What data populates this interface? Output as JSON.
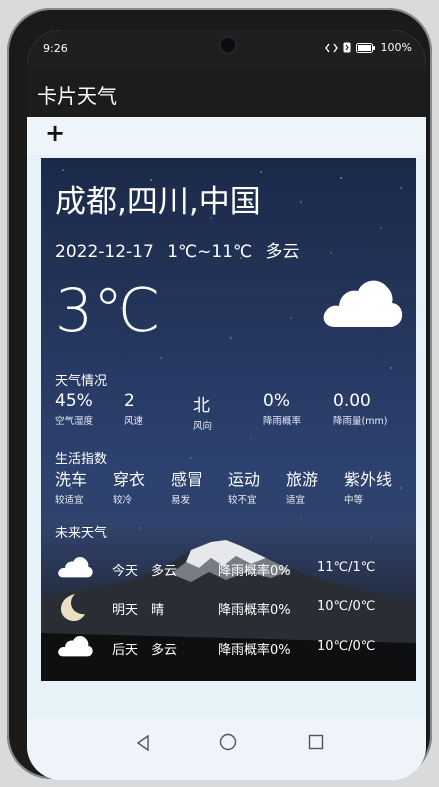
{
  "status_bar": {
    "time": "9:26",
    "battery": "100%",
    "icons": [
      "data-transfer-icon",
      "nfc-icon",
      "battery-icon"
    ]
  },
  "app": {
    "title": "卡片天气"
  },
  "toolbar": {
    "add_label": "+"
  },
  "weather": {
    "city": "成都,四川,中国",
    "date": "2022-12-17",
    "temp_range": "1℃~11℃",
    "condition": "多云",
    "current_temp": "3℃",
    "icon": "cloud-icon",
    "conditions_title": "天气情况",
    "stats": [
      {
        "value": "45%",
        "label": "空气湿度"
      },
      {
        "value": "2",
        "label": "风速"
      },
      {
        "value": "北",
        "label": "风向"
      },
      {
        "value": "0%",
        "label": "降雨概率"
      },
      {
        "value": "0.00",
        "label": "降雨量(mm)"
      }
    ],
    "life_title": "生活指数",
    "life": [
      {
        "value": "洗车",
        "label": "较适宜"
      },
      {
        "value": "穿衣",
        "label": "较冷"
      },
      {
        "value": "感冒",
        "label": "易发"
      },
      {
        "value": "运动",
        "label": "较不宜"
      },
      {
        "value": "旅游",
        "label": "适宜"
      },
      {
        "value": "紫外线",
        "label": "中等"
      }
    ],
    "forecast_title": "未来天气",
    "forecast": [
      {
        "day": "今天",
        "condition": "多云",
        "rain": "降雨概率0%",
        "temps": "11℃/1℃",
        "icon": "cloud-icon"
      },
      {
        "day": "明天",
        "condition": "晴",
        "rain": "降雨概率0%",
        "temps": "10℃/0℃",
        "icon": "moon-icon"
      },
      {
        "day": "后天",
        "condition": "多云",
        "rain": "降雨概率0%",
        "temps": "10℃/0℃",
        "icon": "cloud-icon"
      }
    ]
  },
  "nav": {
    "buttons": [
      "back-icon",
      "home-icon",
      "recent-apps-icon"
    ]
  }
}
